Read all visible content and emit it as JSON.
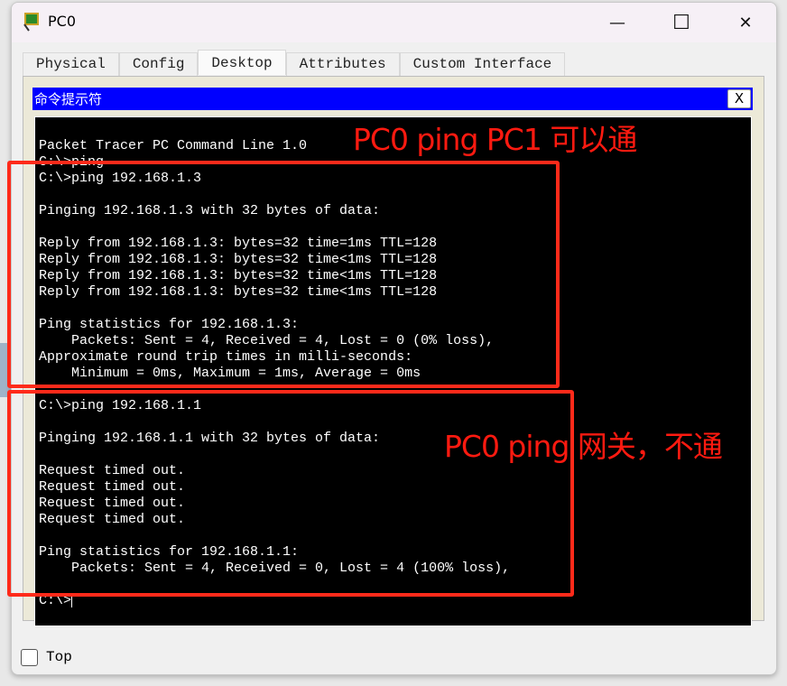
{
  "window": {
    "title": "PC0",
    "minimize": "—",
    "maximize": "☐",
    "close": "✕"
  },
  "tabs": [
    "Physical",
    "Config",
    "Desktop",
    "Attributes",
    "Custom Interface"
  ],
  "active_tab": "Desktop",
  "cmd": {
    "title": "命令提示符",
    "close": "X"
  },
  "terminal": {
    "lines": [
      "Packet Tracer PC Command Line 1.0",
      "C:\\>ping",
      "C:\\>ping 192.168.1.3",
      "",
      "Pinging 192.168.1.3 with 32 bytes of data:",
      "",
      "Reply from 192.168.1.3: bytes=32 time=1ms TTL=128",
      "Reply from 192.168.1.3: bytes=32 time<1ms TTL=128",
      "Reply from 192.168.1.3: bytes=32 time<1ms TTL=128",
      "Reply from 192.168.1.3: bytes=32 time<1ms TTL=128",
      "",
      "Ping statistics for 192.168.1.3:",
      "    Packets: Sent = 4, Received = 4, Lost = 0 (0% loss),",
      "Approximate round trip times in milli-seconds:",
      "    Minimum = 0ms, Maximum = 1ms, Average = 0ms",
      "",
      "C:\\>ping 192.168.1.1",
      "",
      "Pinging 192.168.1.1 with 32 bytes of data:",
      "",
      "Request timed out.",
      "Request timed out.",
      "Request timed out.",
      "Request timed out.",
      "",
      "Ping statistics for 192.168.1.1:",
      "    Packets: Sent = 4, Received = 0, Lost = 4 (100% loss),",
      "",
      "C:\\>"
    ]
  },
  "footer": {
    "top_label": "Top",
    "top_checked": false
  },
  "annotations": {
    "note1": "PC0 ping PC1 可以通",
    "note2": "PC0 ping 网关，不通",
    "color": "#ff2a1a"
  }
}
